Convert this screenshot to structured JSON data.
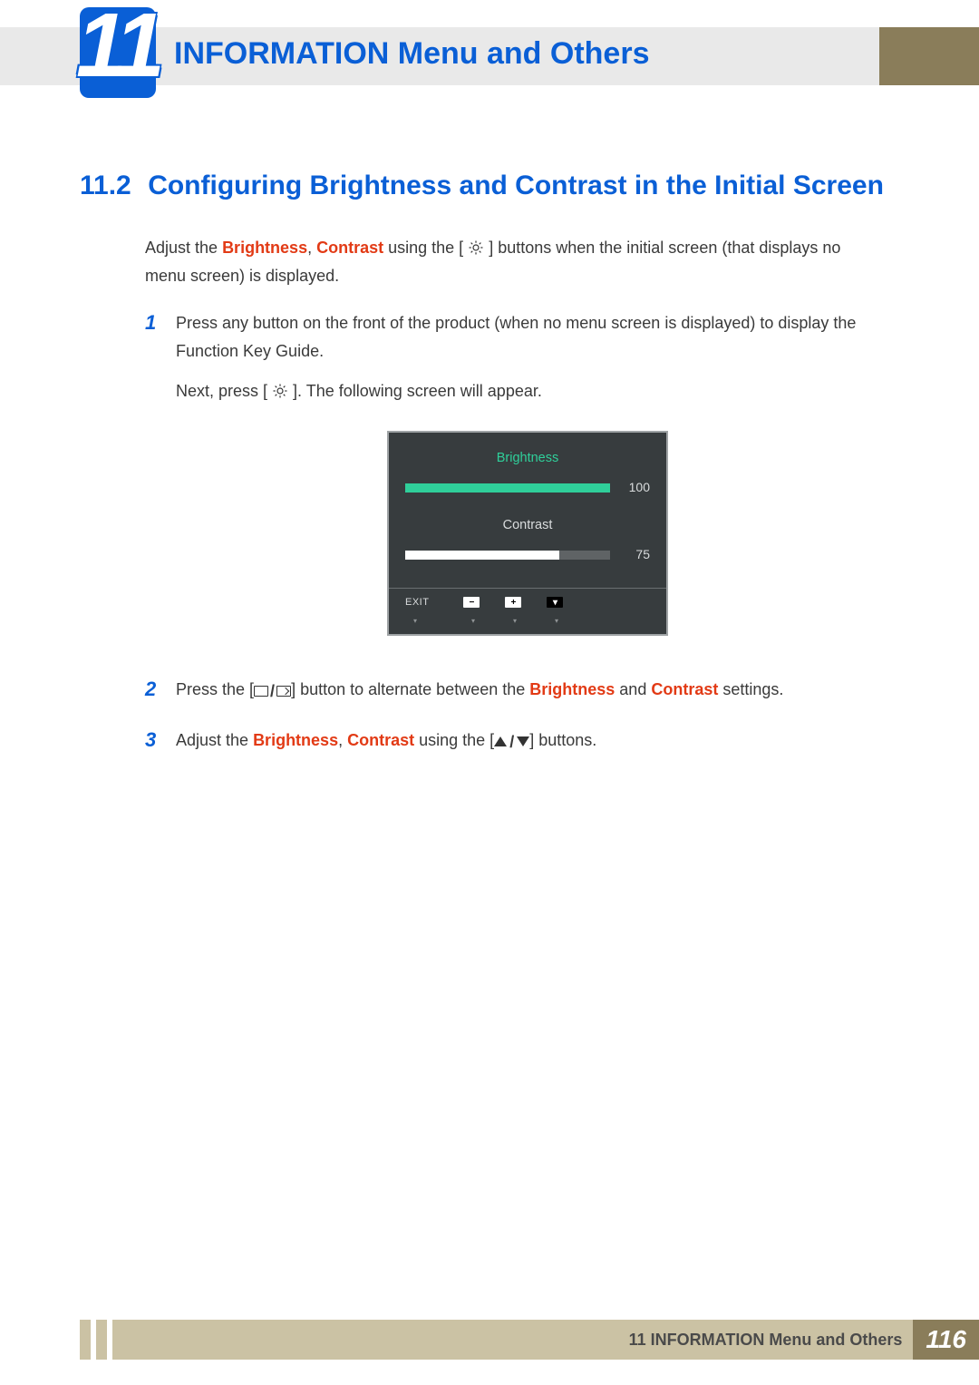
{
  "header": {
    "chapter_number": "11",
    "title": "INFORMATION Menu and Others"
  },
  "section": {
    "number": "11.2",
    "title": "Configuring Brightness and Contrast in the Initial Screen"
  },
  "intro": {
    "pre": "Adjust the ",
    "brightness": "Brightness",
    "sep": ", ",
    "contrast": "Contrast",
    "mid": " using the [ ",
    "post": " ] buttons when the initial screen (that displays no menu screen) is displayed."
  },
  "steps": {
    "s1": {
      "num": "1",
      "p1": "Press any button on the front of the product (when no menu screen is displayed) to display the Function Key Guide.",
      "p2a": "Next, press [ ",
      "p2b": " ]. The following screen will appear."
    },
    "s2": {
      "num": "2",
      "pre": "Press the [",
      "mid": "] button to alternate between the ",
      "brightness": "Brightness",
      "and": " and ",
      "contrast": "Contrast",
      "post": " settings."
    },
    "s3": {
      "num": "3",
      "pre": "Adjust the ",
      "brightness": "Brightness",
      "sep": ", ",
      "contrast": "Contrast",
      "mid": " using the [",
      "post": "] buttons."
    }
  },
  "osd": {
    "brightness_label": "Brightness",
    "brightness_value": "100",
    "contrast_label": "Contrast",
    "contrast_value": "75",
    "exit": "EXIT",
    "btn_minus": "−",
    "btn_plus": "+",
    "btn_down": "▾",
    "arrow": "▾"
  },
  "footer": {
    "text": "11 INFORMATION Menu and Others",
    "page": "116"
  }
}
